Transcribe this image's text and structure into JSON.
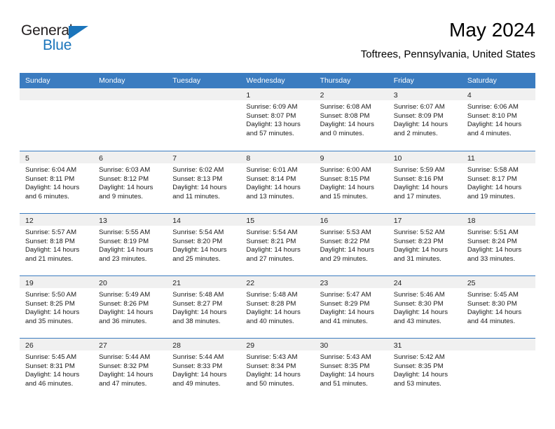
{
  "brand": {
    "name_part1": "General",
    "name_part2": "Blue",
    "accent_color": "#1b75bb"
  },
  "header": {
    "month_title": "May 2024",
    "location": "Toftrees, Pennsylvania, United States"
  },
  "calendar": {
    "header_bg": "#3b7cc0",
    "daynum_band_bg": "#f0f0f0",
    "weekday_headers": [
      "Sunday",
      "Monday",
      "Tuesday",
      "Wednesday",
      "Thursday",
      "Friday",
      "Saturday"
    ],
    "weeks": [
      [
        {
          "day": "",
          "empty": true
        },
        {
          "day": "",
          "empty": true
        },
        {
          "day": "",
          "empty": true
        },
        {
          "day": "1",
          "sunrise": "Sunrise: 6:09 AM",
          "sunset": "Sunset: 8:07 PM",
          "daylight_l1": "Daylight: 13 hours",
          "daylight_l2": "and 57 minutes."
        },
        {
          "day": "2",
          "sunrise": "Sunrise: 6:08 AM",
          "sunset": "Sunset: 8:08 PM",
          "daylight_l1": "Daylight: 14 hours",
          "daylight_l2": "and 0 minutes."
        },
        {
          "day": "3",
          "sunrise": "Sunrise: 6:07 AM",
          "sunset": "Sunset: 8:09 PM",
          "daylight_l1": "Daylight: 14 hours",
          "daylight_l2": "and 2 minutes."
        },
        {
          "day": "4",
          "sunrise": "Sunrise: 6:06 AM",
          "sunset": "Sunset: 8:10 PM",
          "daylight_l1": "Daylight: 14 hours",
          "daylight_l2": "and 4 minutes."
        }
      ],
      [
        {
          "day": "5",
          "sunrise": "Sunrise: 6:04 AM",
          "sunset": "Sunset: 8:11 PM",
          "daylight_l1": "Daylight: 14 hours",
          "daylight_l2": "and 6 minutes."
        },
        {
          "day": "6",
          "sunrise": "Sunrise: 6:03 AM",
          "sunset": "Sunset: 8:12 PM",
          "daylight_l1": "Daylight: 14 hours",
          "daylight_l2": "and 9 minutes."
        },
        {
          "day": "7",
          "sunrise": "Sunrise: 6:02 AM",
          "sunset": "Sunset: 8:13 PM",
          "daylight_l1": "Daylight: 14 hours",
          "daylight_l2": "and 11 minutes."
        },
        {
          "day": "8",
          "sunrise": "Sunrise: 6:01 AM",
          "sunset": "Sunset: 8:14 PM",
          "daylight_l1": "Daylight: 14 hours",
          "daylight_l2": "and 13 minutes."
        },
        {
          "day": "9",
          "sunrise": "Sunrise: 6:00 AM",
          "sunset": "Sunset: 8:15 PM",
          "daylight_l1": "Daylight: 14 hours",
          "daylight_l2": "and 15 minutes."
        },
        {
          "day": "10",
          "sunrise": "Sunrise: 5:59 AM",
          "sunset": "Sunset: 8:16 PM",
          "daylight_l1": "Daylight: 14 hours",
          "daylight_l2": "and 17 minutes."
        },
        {
          "day": "11",
          "sunrise": "Sunrise: 5:58 AM",
          "sunset": "Sunset: 8:17 PM",
          "daylight_l1": "Daylight: 14 hours",
          "daylight_l2": "and 19 minutes."
        }
      ],
      [
        {
          "day": "12",
          "sunrise": "Sunrise: 5:57 AM",
          "sunset": "Sunset: 8:18 PM",
          "daylight_l1": "Daylight: 14 hours",
          "daylight_l2": "and 21 minutes."
        },
        {
          "day": "13",
          "sunrise": "Sunrise: 5:55 AM",
          "sunset": "Sunset: 8:19 PM",
          "daylight_l1": "Daylight: 14 hours",
          "daylight_l2": "and 23 minutes."
        },
        {
          "day": "14",
          "sunrise": "Sunrise: 5:54 AM",
          "sunset": "Sunset: 8:20 PM",
          "daylight_l1": "Daylight: 14 hours",
          "daylight_l2": "and 25 minutes."
        },
        {
          "day": "15",
          "sunrise": "Sunrise: 5:54 AM",
          "sunset": "Sunset: 8:21 PM",
          "daylight_l1": "Daylight: 14 hours",
          "daylight_l2": "and 27 minutes."
        },
        {
          "day": "16",
          "sunrise": "Sunrise: 5:53 AM",
          "sunset": "Sunset: 8:22 PM",
          "daylight_l1": "Daylight: 14 hours",
          "daylight_l2": "and 29 minutes."
        },
        {
          "day": "17",
          "sunrise": "Sunrise: 5:52 AM",
          "sunset": "Sunset: 8:23 PM",
          "daylight_l1": "Daylight: 14 hours",
          "daylight_l2": "and 31 minutes."
        },
        {
          "day": "18",
          "sunrise": "Sunrise: 5:51 AM",
          "sunset": "Sunset: 8:24 PM",
          "daylight_l1": "Daylight: 14 hours",
          "daylight_l2": "and 33 minutes."
        }
      ],
      [
        {
          "day": "19",
          "sunrise": "Sunrise: 5:50 AM",
          "sunset": "Sunset: 8:25 PM",
          "daylight_l1": "Daylight: 14 hours",
          "daylight_l2": "and 35 minutes."
        },
        {
          "day": "20",
          "sunrise": "Sunrise: 5:49 AM",
          "sunset": "Sunset: 8:26 PM",
          "daylight_l1": "Daylight: 14 hours",
          "daylight_l2": "and 36 minutes."
        },
        {
          "day": "21",
          "sunrise": "Sunrise: 5:48 AM",
          "sunset": "Sunset: 8:27 PM",
          "daylight_l1": "Daylight: 14 hours",
          "daylight_l2": "and 38 minutes."
        },
        {
          "day": "22",
          "sunrise": "Sunrise: 5:48 AM",
          "sunset": "Sunset: 8:28 PM",
          "daylight_l1": "Daylight: 14 hours",
          "daylight_l2": "and 40 minutes."
        },
        {
          "day": "23",
          "sunrise": "Sunrise: 5:47 AM",
          "sunset": "Sunset: 8:29 PM",
          "daylight_l1": "Daylight: 14 hours",
          "daylight_l2": "and 41 minutes."
        },
        {
          "day": "24",
          "sunrise": "Sunrise: 5:46 AM",
          "sunset": "Sunset: 8:30 PM",
          "daylight_l1": "Daylight: 14 hours",
          "daylight_l2": "and 43 minutes."
        },
        {
          "day": "25",
          "sunrise": "Sunrise: 5:45 AM",
          "sunset": "Sunset: 8:30 PM",
          "daylight_l1": "Daylight: 14 hours",
          "daylight_l2": "and 44 minutes."
        }
      ],
      [
        {
          "day": "26",
          "sunrise": "Sunrise: 5:45 AM",
          "sunset": "Sunset: 8:31 PM",
          "daylight_l1": "Daylight: 14 hours",
          "daylight_l2": "and 46 minutes."
        },
        {
          "day": "27",
          "sunrise": "Sunrise: 5:44 AM",
          "sunset": "Sunset: 8:32 PM",
          "daylight_l1": "Daylight: 14 hours",
          "daylight_l2": "and 47 minutes."
        },
        {
          "day": "28",
          "sunrise": "Sunrise: 5:44 AM",
          "sunset": "Sunset: 8:33 PM",
          "daylight_l1": "Daylight: 14 hours",
          "daylight_l2": "and 49 minutes."
        },
        {
          "day": "29",
          "sunrise": "Sunrise: 5:43 AM",
          "sunset": "Sunset: 8:34 PM",
          "daylight_l1": "Daylight: 14 hours",
          "daylight_l2": "and 50 minutes."
        },
        {
          "day": "30",
          "sunrise": "Sunrise: 5:43 AM",
          "sunset": "Sunset: 8:35 PM",
          "daylight_l1": "Daylight: 14 hours",
          "daylight_l2": "and 51 minutes."
        },
        {
          "day": "31",
          "sunrise": "Sunrise: 5:42 AM",
          "sunset": "Sunset: 8:35 PM",
          "daylight_l1": "Daylight: 14 hours",
          "daylight_l2": "and 53 minutes."
        },
        {
          "day": "",
          "empty": true
        }
      ]
    ]
  }
}
